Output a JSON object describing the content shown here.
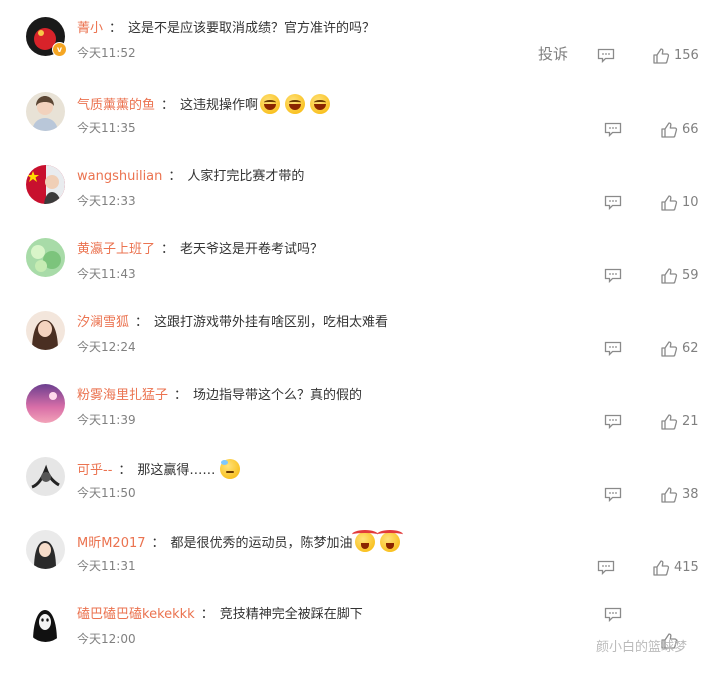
{
  "comments": [
    {
      "user": "菁小",
      "text": "这是不是应该要取消成绩？官方准许的吗？",
      "time": "今天11:52",
      "likes": "156",
      "report": "投诉",
      "emojis": []
    },
    {
      "user": "气质薰薰的鱼",
      "text": "这违规操作啊",
      "time": "今天11:35",
      "likes": "66",
      "emojis": [
        "laugh",
        "laugh",
        "laugh"
      ]
    },
    {
      "user": "wangshuilian",
      "text": "人家打完比赛才带的",
      "time": "今天12:33",
      "likes": "10",
      "emojis": []
    },
    {
      "user": "黄瀛子上班了",
      "text": "老天爷这是开卷考试吗？",
      "time": "今天11:43",
      "likes": "59",
      "emojis": []
    },
    {
      "user": "汐澜雪狐",
      "text": "这跟打游戏带外挂有啥区别，吃相太难看",
      "time": "今天12:24",
      "likes": "62",
      "emojis": []
    },
    {
      "user": "粉雾海里扎猛子",
      "text": "场边指导带这个么？真的假的",
      "time": "今天11:39",
      "likes": "21",
      "emojis": []
    },
    {
      "user": "可乎--",
      "text": "那这赢得……",
      "time": "今天11:50",
      "likes": "38",
      "emojis": [
        "sweat"
      ]
    },
    {
      "user": "M昕M2017",
      "text": "都是很优秀的运动员，陈梦加油",
      "time": "今天11:31",
      "likes": "415",
      "emojis": [
        "cheer",
        "cheer"
      ]
    },
    {
      "user": "磕巴磕巴磕kekekkk",
      "text": "竞技精神完全被踩在脚下",
      "time": "今天12:00",
      "likes": "",
      "emojis": []
    }
  ],
  "separator": "：",
  "watermark": "颜小白的篮球梦",
  "icons": {
    "reply": "comment-icon",
    "like": "thumbs-up-icon",
    "verified": "verified-badge-icon"
  },
  "colors": {
    "username": "#eb7350",
    "muted": "#808080",
    "text": "#333333"
  }
}
